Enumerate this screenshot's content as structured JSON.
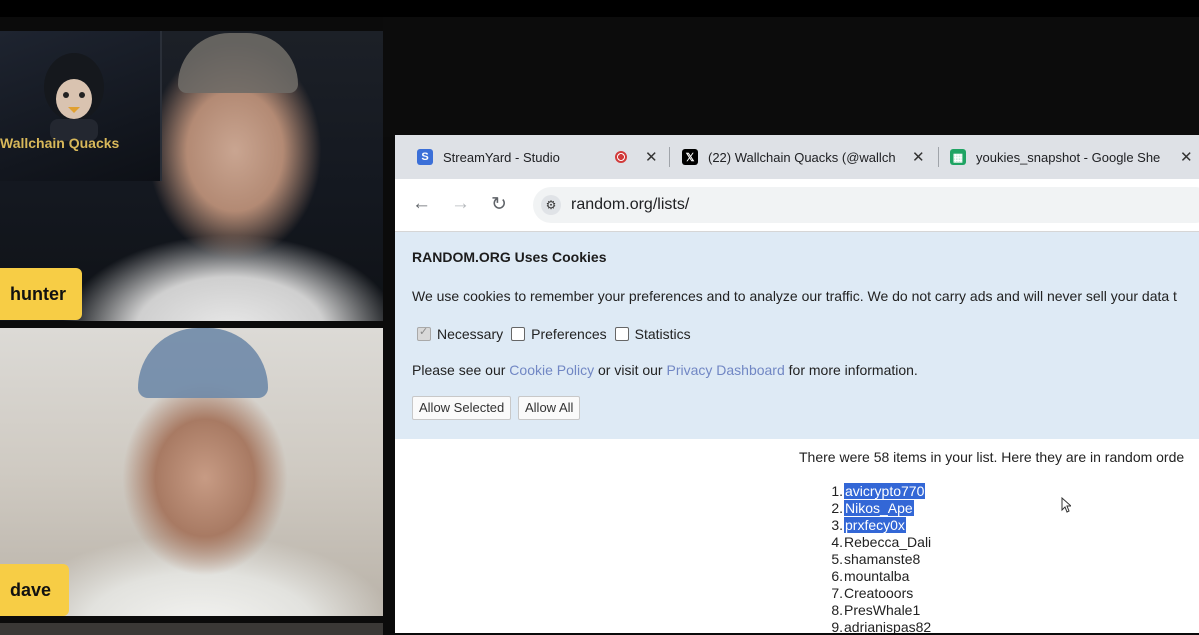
{
  "participants": [
    {
      "name": "hunter",
      "poster_text": "Wallchain Quacks"
    },
    {
      "name": "dave"
    }
  ],
  "colors": {
    "name_tag": "#f7cd45",
    "link": "#7187c4",
    "selection": "#3367d6",
    "cookie_bg": "#deeaf5"
  },
  "browser": {
    "tabs": [
      {
        "title": "StreamYard - Studio",
        "icon": "streamyard-icon"
      },
      {
        "title": "(22) Wallchain Quacks (@wallch",
        "icon": "x-icon"
      },
      {
        "title": "youkies_snapshot - Google She",
        "icon": "google-sheets-icon"
      }
    ],
    "url": "random.org/lists/"
  },
  "cookie_banner": {
    "title": "RANDOM.ORG Uses Cookies",
    "description": "We use cookies to remember your preferences and to analyze our traffic. We do not carry ads and will never sell your data t",
    "checkboxes": [
      {
        "label": "Necessary",
        "checked": true
      },
      {
        "label": "Preferences",
        "checked": false
      },
      {
        "label": "Statistics",
        "checked": false
      }
    ],
    "see_prefix": "Please see our",
    "cookie_policy": "Cookie Policy",
    "or_visit": "or visit our",
    "privacy_dashboard": "Privacy Dashboard",
    "see_suffix": "for more information.",
    "allow_selected": "Allow Selected",
    "allow_all": "Allow All"
  },
  "results": {
    "summary": "There were 58 items in your list. Here they are in random orde",
    "items": [
      {
        "num": "1.",
        "text": "avicrypto770"
      },
      {
        "num": "2.",
        "text": "Nikos_Ape"
      },
      {
        "num": "3.",
        "text": "prxfecy0x"
      },
      {
        "num": "4.",
        "text": "Rebecca_Dali"
      },
      {
        "num": "5.",
        "text": "shamanste8"
      },
      {
        "num": "6.",
        "text": "mountalba"
      },
      {
        "num": "7.",
        "text": "Creatooors"
      },
      {
        "num": "8.",
        "text": "PresWhale1"
      },
      {
        "num": "9.",
        "text": "adrianispas82"
      }
    ]
  }
}
